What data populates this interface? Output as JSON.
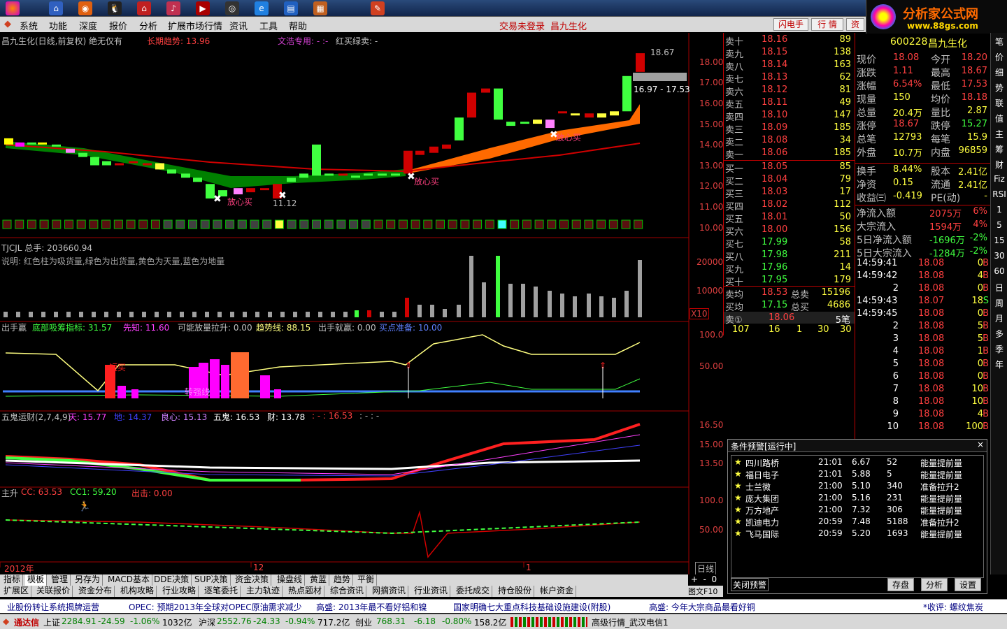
{
  "toolbar": {
    "icons": [
      "pie-logo-icon",
      "home-icon",
      "browser-icon",
      "qq-icon",
      "home2-icon",
      "music-icon",
      "media-icon",
      "ie-icon",
      "book-icon",
      "chart-icon",
      "note-icon"
    ]
  },
  "menu": {
    "items": [
      "系统",
      "功能",
      "深度",
      "报价",
      "分析",
      "扩展市场行情",
      "资讯",
      "工具",
      "帮助"
    ],
    "center_text": "交易未登录",
    "stock_name": "昌九生化",
    "btn_flash": "闪电手",
    "btn_quote": "行 情",
    "btn_info": "资"
  },
  "logo": {
    "title": "分析家公式网",
    "url": "www.88gs.com"
  },
  "chart": {
    "title": "昌九生化(日线,前复权) 绝无仅有",
    "long_trend": "长期趋势: 13.96",
    "wenjie": "文浩专用: - :-",
    "redgreen": "红买绿卖: -",
    "price_hi_label": "18.67",
    "range_label": "16.97 - 17.53",
    "low_label": "11.12",
    "buy1": "放心买",
    "buy2": "放心买",
    "buy3": "放心买",
    "buy4": "放心买",
    "price_axis": [
      "18.00",
      "17.00",
      "16.00",
      "15.00",
      "14.00",
      "13.00",
      "12.00",
      "11.00",
      "10.00"
    ],
    "p2_title": "TJCJL 总手: 203660.94",
    "p2_desc": "说明: 红色柱为吸货量,绿色为出货量,黄色为天量,蓝色为地量",
    "p2_axis": [
      "20000",
      "10000",
      "X10"
    ],
    "p3_labels": [
      "出手赢",
      "底部吸筹指标: 31.57",
      "先知: 11.60",
      "可能放量拉升: 0.00",
      "趋势线: 88.15",
      "出手就赢: 0.00",
      "买点准备: 10.00"
    ],
    "p3_axis": [
      "100.0",
      "50.00"
    ],
    "p3_buy": "短买",
    "p3_buy2": "转强线",
    "p4_labels": [
      "五鬼运财(2,7,4,9)",
      "天: 15.77",
      "地: 14.37",
      "良心: 15.13",
      "五鬼: 16.53",
      "财: 13.78",
      ": - : 16.53",
      ": - : -"
    ],
    "p4_axis": [
      "16.50",
      "15.00",
      "13.50"
    ],
    "p5_labels": [
      "主升",
      "CC: 63.53",
      "CC1: 59.20",
      "出击: 0.00"
    ],
    "p5_axis": [
      "100.0",
      "50.00"
    ],
    "date_labels": [
      "2012年",
      "12",
      "1"
    ],
    "period": "日线"
  },
  "quote": {
    "sell": [
      [
        "卖十",
        "18.16",
        "89"
      ],
      [
        "卖九",
        "18.15",
        "138"
      ],
      [
        "卖八",
        "18.14",
        "163"
      ],
      [
        "卖七",
        "18.13",
        "62"
      ],
      [
        "卖六",
        "18.12",
        "81"
      ],
      [
        "卖五",
        "18.11",
        "49"
      ],
      [
        "卖四",
        "18.10",
        "147"
      ],
      [
        "卖三",
        "18.09",
        "185"
      ],
      [
        "卖二",
        "18.08",
        "34"
      ],
      [
        "卖一",
        "18.06",
        "185"
      ]
    ],
    "buy": [
      [
        "买一",
        "18.05",
        "85"
      ],
      [
        "买二",
        "18.04",
        "79"
      ],
      [
        "买三",
        "18.03",
        "17"
      ],
      [
        "买四",
        "18.02",
        "112"
      ],
      [
        "买五",
        "18.01",
        "50"
      ],
      [
        "买六",
        "18.00",
        "156"
      ],
      [
        "买七",
        "17.99",
        "58"
      ],
      [
        "买八",
        "17.98",
        "211"
      ],
      [
        "买九",
        "17.96",
        "14"
      ],
      [
        "买十",
        "17.95",
        "179"
      ]
    ],
    "avg_sell": [
      "卖均",
      "18.53",
      "总卖",
      "15196"
    ],
    "avg_buy": [
      "买均",
      "17.15",
      "总买",
      "4686"
    ],
    "sell1": [
      "卖①",
      "18.06",
      "5笔"
    ],
    "queue": [
      "107",
      "16",
      "1",
      "30",
      "30"
    ]
  },
  "stats": {
    "code": "600228",
    "name": "昌九生化",
    "rows": [
      [
        "现价",
        "18.08",
        "今开",
        "18.20"
      ],
      [
        "涨跌",
        "1.11",
        "最高",
        "18.67"
      ],
      [
        "涨幅",
        "6.54%",
        "最低",
        "17.53"
      ],
      [
        "现量",
        "150",
        "均价",
        "18.18"
      ],
      [
        "总量",
        "20.4万",
        "量比",
        "2.87"
      ],
      [
        "涨停",
        "18.67",
        "跌停",
        "15.27"
      ],
      [
        "总笔",
        "12793",
        "每笔",
        "15.9"
      ],
      [
        "外盘",
        "10.7万",
        "内盘",
        "96859"
      ],
      [
        "换手",
        "8.44%",
        "股本",
        "2.41亿"
      ],
      [
        "净资",
        "0.15",
        "流通",
        "2.41亿"
      ],
      [
        "收益㈢",
        "-0.419",
        "PE(动)",
        "-"
      ],
      [
        "净流入额",
        "",
        "2075万",
        "6%"
      ],
      [
        "大宗流入",
        "",
        "1594万",
        "4%"
      ],
      [
        "5日净流入额",
        "",
        "-1696万",
        "-2%"
      ],
      [
        "5日大宗流入",
        "",
        "-1284万",
        "-2%"
      ]
    ]
  },
  "ticks": [
    [
      "14:59:41",
      "18.08",
      "0",
      "B"
    ],
    [
      "14:59:42",
      "18.08",
      "4",
      "B"
    ],
    [
      "2",
      "18.08",
      "0",
      "B"
    ],
    [
      "14:59:43",
      "18.07",
      "18",
      "S"
    ],
    [
      "14:59:45",
      "18.08",
      "0",
      "B"
    ],
    [
      "2",
      "18.08",
      "5",
      "B"
    ],
    [
      "3",
      "18.08",
      "5",
      "B"
    ],
    [
      "4",
      "18.08",
      "1",
      "B"
    ],
    [
      "5",
      "18.08",
      "0",
      "B"
    ],
    [
      "6",
      "18.08",
      "0",
      "B"
    ],
    [
      "7",
      "18.08",
      "10",
      "B"
    ],
    [
      "8",
      "18.08",
      "10",
      "B"
    ],
    [
      "9",
      "18.08",
      "4",
      "B"
    ],
    [
      "10",
      "18.08",
      "100",
      "B"
    ]
  ],
  "rtabs": [
    "笔",
    "价",
    "细",
    "势",
    "联",
    "值",
    "主",
    "筹",
    "财",
    "Fiz",
    "RSI",
    "1",
    "5",
    "15",
    "30",
    "60",
    "日",
    "周",
    "月",
    "多",
    "季",
    "年"
  ],
  "alert": {
    "title": "条件预警[运行中]",
    "rows": [
      [
        "四川路桥",
        "21:01",
        "6.67",
        "52",
        "能量提前量"
      ],
      [
        "福日电子",
        "21:01",
        "5.88",
        "5",
        "能量提前量"
      ],
      [
        "士兰微",
        "21:00",
        "5.10",
        "340",
        "准备拉升2"
      ],
      [
        "庞大集团",
        "21:00",
        "5.16",
        "231",
        "能量提前量"
      ],
      [
        "万方地产",
        "21:00",
        "7.32",
        "306",
        "能量提前量"
      ],
      [
        "凯迪电力",
        "20:59",
        "7.48",
        "5188",
        "准备拉升2"
      ],
      [
        "飞马国际",
        "20:59",
        "5.20",
        "1693",
        "能量提前量"
      ]
    ],
    "btn_close": "关闭预警",
    "btn_save": "存盘",
    "btn_analyze": "分析",
    "btn_settings": "设置"
  },
  "tabs1": [
    "指标",
    "模板",
    "管理",
    "另存为",
    "MACD基本",
    "DDE决策",
    "SUP决策",
    "资金决策",
    "操盘线",
    "黄蓝",
    "趋势",
    "平衡"
  ],
  "tabs2": [
    "扩展区",
    "关联报价",
    "资金分布",
    "机构攻略",
    "行业攻略",
    "逐笔委托",
    "主力轨迹",
    "热点题材",
    "综合资讯",
    "网摘资讯",
    "行业资讯",
    "委托成交",
    "持仓股份",
    "帐户资金"
  ],
  "tabs_right": [
    "图文F10"
  ],
  "news": [
    "业股份转让系统揭牌运营",
    "OPEC: 预期2013年全球对OPEC原油需求减少",
    "高盛: 2013年最不看好铝和镍",
    "国家明确七大重点科技基础设施建设(附股)",
    "高盛: 今年大宗商品最看好铜",
    "*收评: 螺纹焦炭"
  ],
  "status": {
    "brand": "通达信",
    "sh": "上证",
    "sh_val": "2284.91",
    "sh_chg": "-24.59",
    "sh_pct": "-1.06%",
    "sh_amt": "1032亿",
    "sz": "沪深",
    "sz_val": "2552.76",
    "sz_chg": "-24.33",
    "sz_pct": "-0.94%",
    "sz_amt": "717.2亿",
    "cy": "创业",
    "cy_val": "768.31",
    "cy_chg": "-6.18",
    "cy_pct": "-0.80%",
    "cy_amt": "158.2亿",
    "server": "高级行情_武汉电信1"
  }
}
